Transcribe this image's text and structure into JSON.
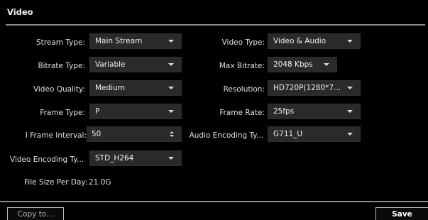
{
  "title": "Video",
  "left": [
    {
      "label": "Stream Type:",
      "value": "Main Stream",
      "control": "dropdown"
    },
    {
      "label": "Bitrate Type:",
      "value": "Variable",
      "control": "dropdown"
    },
    {
      "label": "Video Quality:",
      "value": "Medium",
      "control": "dropdown"
    },
    {
      "label": "Frame Type:",
      "value": "P",
      "control": "dropdown"
    },
    {
      "label": "I Frame Interval:",
      "value": "50",
      "control": "stepper"
    },
    {
      "label": "Video Encoding Ty...",
      "value": "STD_H264",
      "control": "dropdown"
    }
  ],
  "right": [
    {
      "label": "Video Type:",
      "value": "Video & Audio",
      "control": "dropdown"
    },
    {
      "label": "Max Bitrate:",
      "value": "2048 Kbps",
      "control": "dropdown"
    },
    {
      "label": "Resolution:",
      "value": "HD720P(1280*7...",
      "control": "dropdown"
    },
    {
      "label": "Frame Rate:",
      "value": "25fps",
      "control": "dropdown"
    },
    {
      "label": "Audio Encoding Ty...",
      "value": "G711_U",
      "control": "dropdown"
    }
  ],
  "file_size": {
    "label": "File Size Per Day:",
    "value": "21.0G"
  },
  "buttons": {
    "copy": "Copy to...",
    "save": "Save"
  },
  "colors": {
    "background": "#000000",
    "field": "#2a2a2a",
    "rule": "#8a8a8a"
  }
}
